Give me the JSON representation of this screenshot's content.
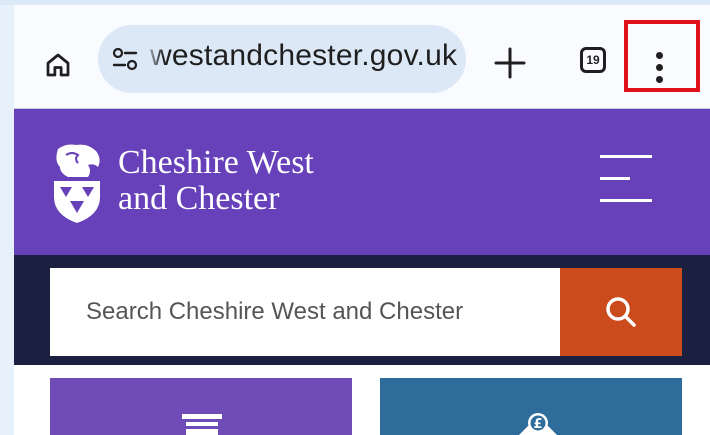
{
  "browser": {
    "url": "westandchester.gov.uk",
    "tab_count": "19",
    "icons": [
      "home-icon",
      "site-info-icon",
      "new-tab-icon",
      "tab-switcher-icon",
      "more-options-icon"
    ]
  },
  "site": {
    "name_line1": "Cheshire West",
    "name_line2": "and Chester",
    "brand_color": "#6741b9",
    "search": {
      "placeholder": "Search Cheshire West and Chester"
    },
    "tiles": [
      {
        "icon": "bin-icon",
        "color": "#6e4bb6"
      },
      {
        "icon": "money-icon",
        "color": "#2e6c9b"
      }
    ]
  },
  "annotation": {
    "highlight_color": "#e0101a"
  }
}
